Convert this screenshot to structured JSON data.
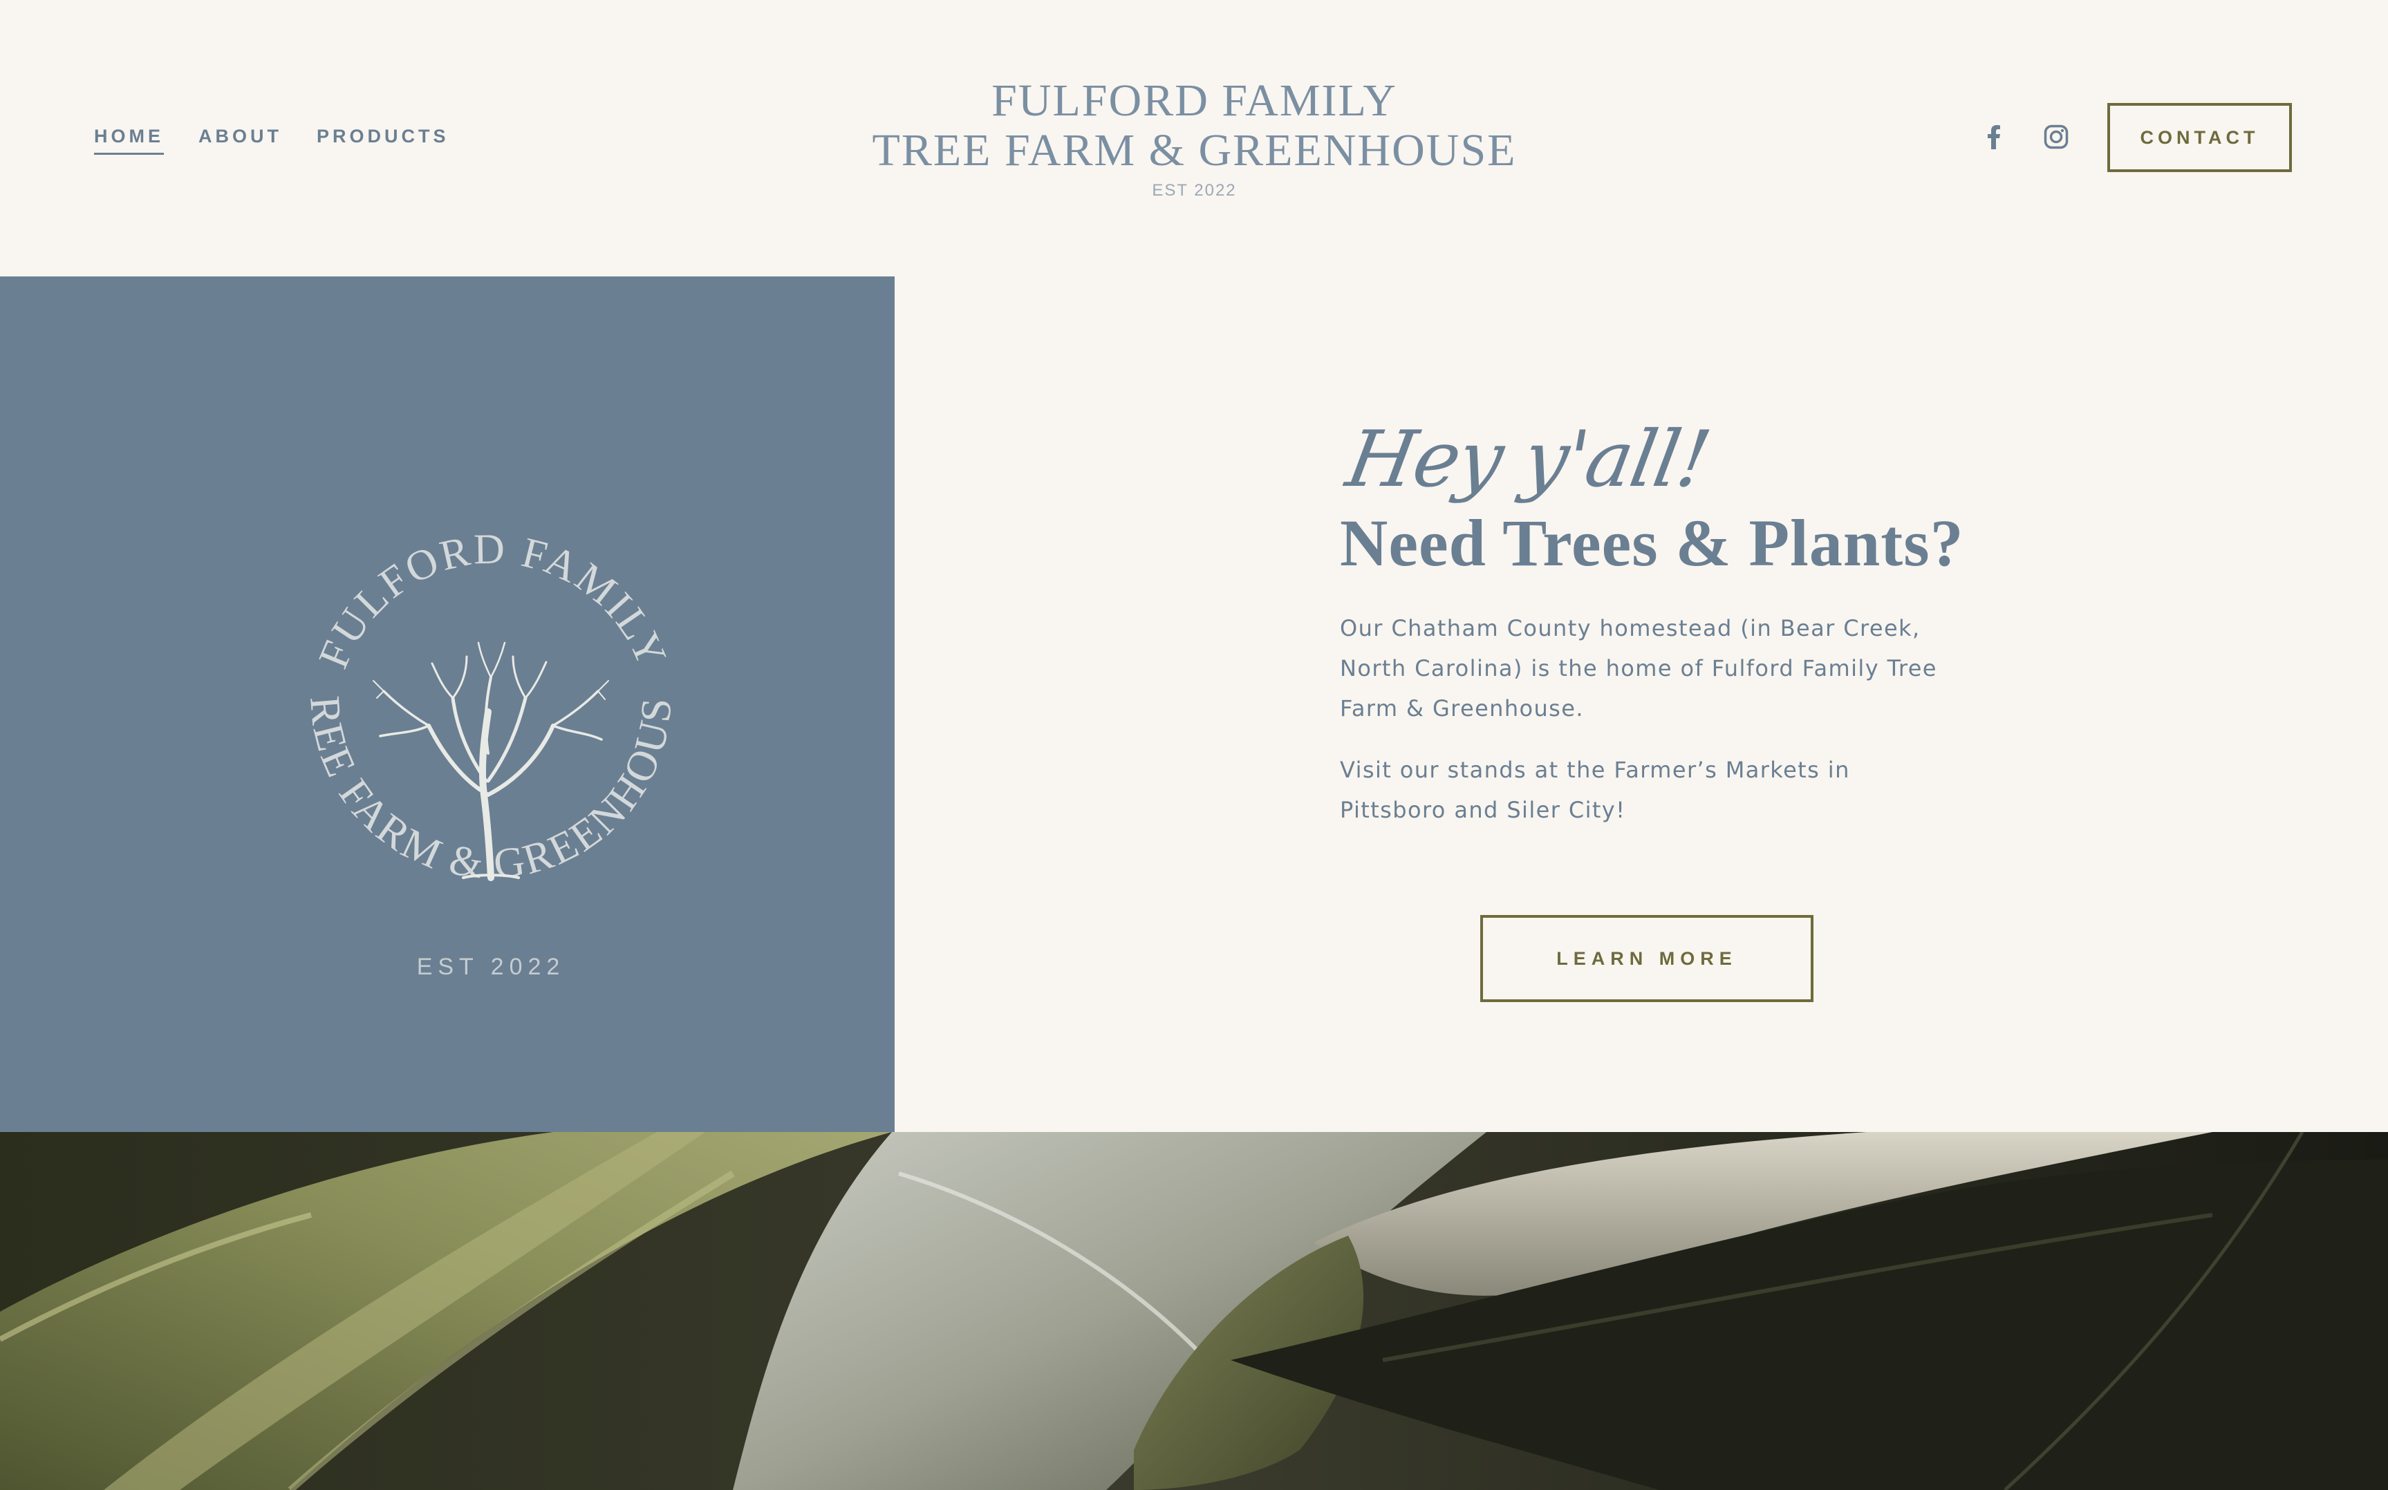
{
  "nav": {
    "items": [
      {
        "label": "HOME",
        "active": true
      },
      {
        "label": "ABOUT",
        "active": false
      },
      {
        "label": "PRODUCTS",
        "active": false
      }
    ]
  },
  "brand": {
    "line1": "FULFORD FAMILY",
    "line2": "TREE FARM & GREENHOUSE",
    "est": "EST 2022"
  },
  "social": {
    "facebook_icon": "facebook-icon",
    "instagram_icon": "instagram-icon"
  },
  "header": {
    "contact_label": "CONTACT"
  },
  "emblem": {
    "top_arc": "FULFORD FAMILY",
    "bottom_arc": "TREE FARM & GREENHOUSE",
    "est": "EST 2022",
    "icon": "tree-icon"
  },
  "hero": {
    "script": "Hey y'all!",
    "headline": "Need Trees & Plants?",
    "paragraph1": "Our Chatham County homestead (in Bear Creek, North Carolina) is the home of Fulford Family Tree Farm & Greenhouse.",
    "paragraph2": "Visit our stands at the Farmer’s Markets in Pittsboro and Siler City!",
    "cta_label": "LEARN MORE"
  },
  "colors": {
    "background": "#f9f5f0",
    "slate": "#6b7f92",
    "olive": "#6e6b3d",
    "leaf_dark": "#1d1e16"
  }
}
